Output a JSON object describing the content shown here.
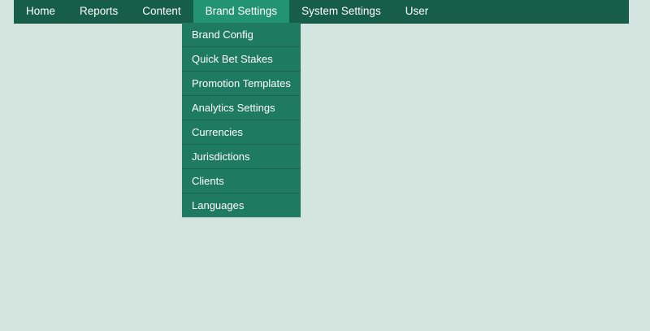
{
  "nav": {
    "items": [
      {
        "label": "Home"
      },
      {
        "label": "Reports"
      },
      {
        "label": "Content"
      },
      {
        "label": "Brand Settings"
      },
      {
        "label": "System Settings"
      },
      {
        "label": "User"
      }
    ],
    "active": "Brand Settings"
  },
  "dropdown": {
    "items": [
      {
        "label": "Brand Config"
      },
      {
        "label": "Quick Bet Stakes"
      },
      {
        "label": "Promotion Templates"
      },
      {
        "label": "Analytics Settings"
      },
      {
        "label": "Currencies"
      },
      {
        "label": "Jurisdictions"
      },
      {
        "label": "Clients"
      },
      {
        "label": "Languages"
      }
    ]
  },
  "colors": {
    "background": "#d4e5e0",
    "navbar": "#175e4a",
    "active_tab": "#229473",
    "dropdown": "#1f7a62"
  }
}
